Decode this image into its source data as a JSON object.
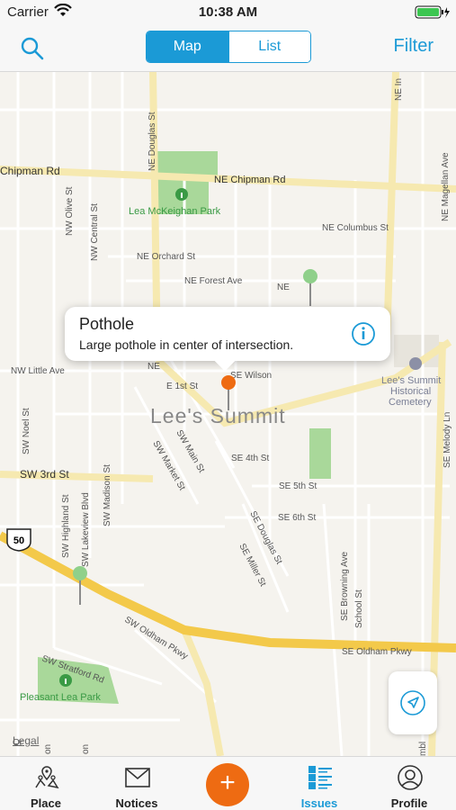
{
  "status": {
    "carrier": "Carrier",
    "time": "10:38 AM"
  },
  "nav": {
    "segments": [
      "Map",
      "List"
    ],
    "active_segment": "Map",
    "filter_label": "Filter"
  },
  "map": {
    "labels": {
      "chipman_rd": "Chipman Rd",
      "ne_chipman_rd": "NE Chipman Rd",
      "ne_douglas_st": "NE Douglas St",
      "ne_magellan_ave": "NE Magellan Ave",
      "ne_columbus_st": "NE Columbus St",
      "nw_olive_st": "NW Olive St",
      "nw_central_st": "NW Central St",
      "ne_orchard_st": "NE Orchard St",
      "ne_forest_ave": "NE Forest Ave",
      "nw_little_ave": "NW Little Ave",
      "e_1st_st": "E 1st St",
      "se_wilson": "SE Wilson",
      "ne_short": "NE",
      "ne_right": "NE",
      "city": "Lee's Summit",
      "lsh_cemetery_1": "Lee's Summit",
      "lsh_cemetery_2": "Historical",
      "lsh_cemetery_3": "Cemetery",
      "sw_noel_st": "SW Noel St",
      "sw_3rd_st": "SW 3rd St",
      "sw_market_st": "SW Market St",
      "sw_main_st": "SW Main St",
      "se_4th_st": "SE 4th St",
      "se_5th_st": "SE 5th St",
      "se_6th_st": "SE 6th St",
      "se_douglas_st": "SE Douglas St",
      "se_miller_st": "SE Miller St",
      "se_browning_ave": "SE Browning Ave",
      "school_st": "School St",
      "se_melody_ln": "SE Melody Ln",
      "sw_highland_st": "SW Highland St",
      "sw_lakeview_blvd": "SW Lakeview Blvd",
      "sw_madison_st": "SW Madison St",
      "sw_oldham_pkwy": "SW Oldham Pkwy",
      "se_oldham_pkwy": "SE Oldham Pkwy",
      "sw_stratford_rd": "SW Stratford Rd",
      "pleasant_lea_park": "Pleasant Lea Park",
      "lea_mckeighan_park": "Lea McKeighan Park",
      "route_50": "50",
      "sw_orr": "Or",
      "sw_on": "on",
      "ne_top": "NE In",
      "se_bottom": "mbl"
    },
    "legal": "Legal"
  },
  "callout": {
    "title": "Pothole",
    "description": "Large pothole in center of intersection."
  },
  "tabs": [
    {
      "label": "Place"
    },
    {
      "label": "Notices"
    },
    {
      "label": "Issues"
    },
    {
      "label": "Profile"
    }
  ],
  "colors": {
    "accent": "#1b9ad6",
    "add": "#ee6b12",
    "park": "#a9d89a",
    "pin_green": "#8fd08a",
    "pin_orange": "#ee6b12"
  }
}
